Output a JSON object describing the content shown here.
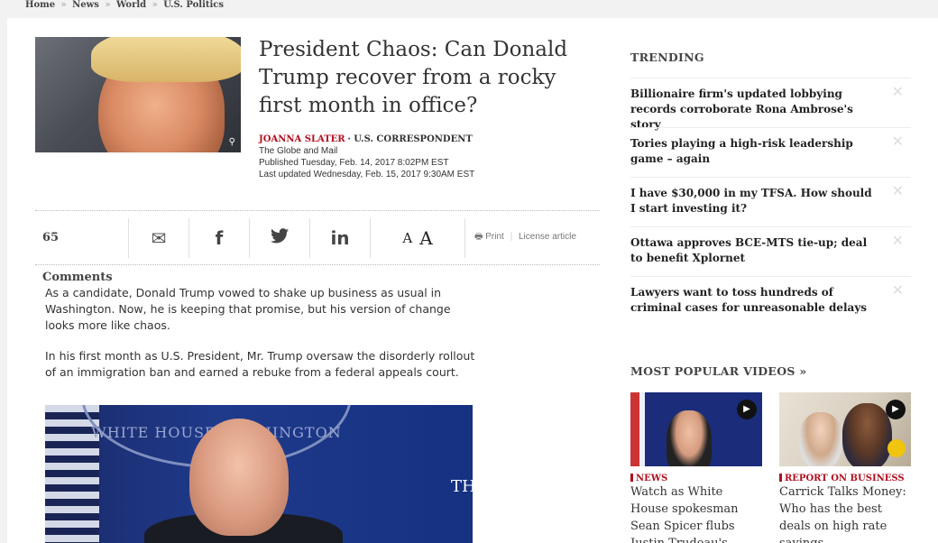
{
  "breadcrumb": {
    "items": [
      "Home",
      "News",
      "World",
      "U.S. Politics"
    ],
    "separator": "»"
  },
  "article": {
    "headline": "President Chaos: Can Donald Trump recover from a rocky first month in office?",
    "author": "JOANNA SLATER",
    "author_role": "· U.S. CORRESPONDENT",
    "publication": "The Globe and Mail",
    "published": "Published Tuesday, Feb. 14, 2017 8:02PM EST",
    "updated": "Last updated Wednesday, Feb. 15, 2017 9:30AM EST",
    "thumb_zoom_icon": "⚲",
    "paragraphs": [
      "As a candidate, Donald Trump vowed to shake up business as usual in Washington. Now, he is keeping that promise, but his version of change looks more like chaos.",
      "In his first month as U.S. President, Mr. Trump oversaw the disorderly rollout of an immigration ban and earned a rebuke from a federal appeals court."
    ],
    "image_seal_text": "WHITE HOUSE WASHINGTON",
    "image_overlay_text": "TH"
  },
  "share_bar": {
    "comments": "65 Comments",
    "email_icon": "✉",
    "facebook_icon": "f",
    "twitter_icon": "🐦",
    "linkedin_icon": "in",
    "font_small": "A",
    "font_large": "A",
    "print_icon": "🖶",
    "print_label": "Print",
    "license_label": "License article"
  },
  "sidebar": {
    "trending_title": "TRENDING",
    "close_icon": "✕",
    "trending": [
      "Billionaire firm's updated lobbying records corroborate Rona Ambrose's story",
      "Tories playing a high-risk leadership game – again",
      "I have $30,000 in my TFSA. How should I start investing it?",
      "Ottawa approves BCE-MTS tie-up; deal to benefit Xplornet",
      "Lawyers want to toss hundreds of criminal cases for unreasonable delays"
    ],
    "videos_title": "MOST POPULAR VIDEOS »",
    "play_icon": "▶",
    "videos": [
      {
        "category": "NEWS",
        "title": "Watch as White House spokesman Sean Spicer flubs Justin Trudeau's"
      },
      {
        "category": "REPORT ON BUSINESS",
        "title": "Carrick Talks Money: Who has the best deals on high rate savings"
      }
    ]
  }
}
